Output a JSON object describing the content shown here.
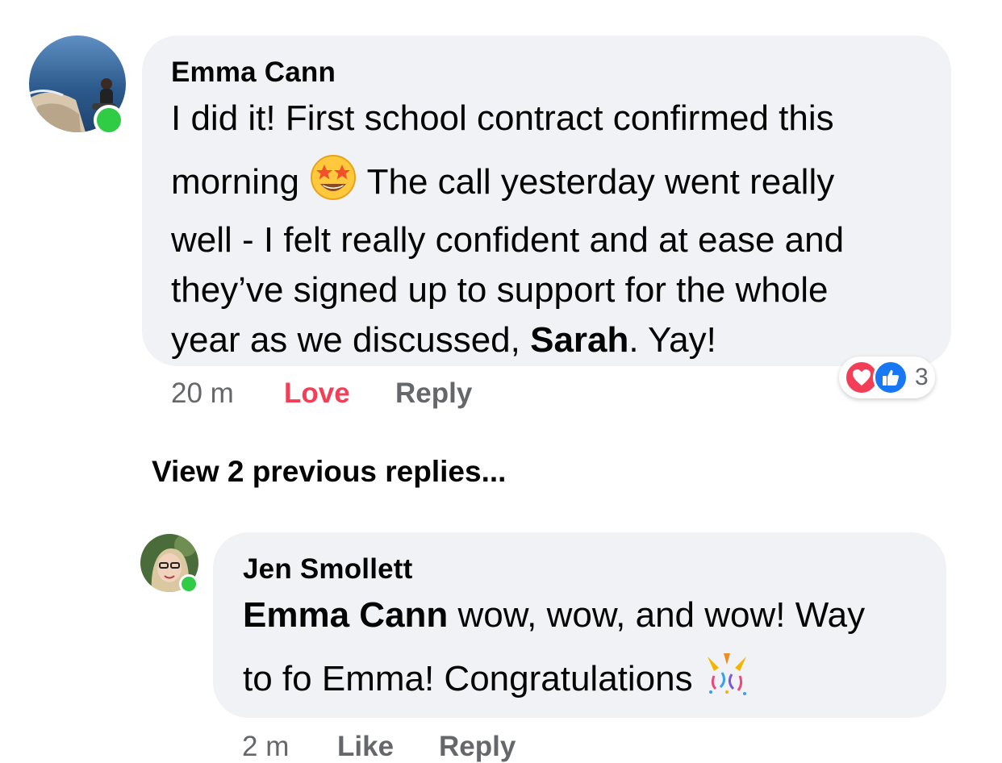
{
  "comment": {
    "author": "Emma Cann",
    "text_line1": "I did it! First school contract confirmed this",
    "text_line2_a": "morning",
    "text_line2_emoji": "star-struck-emoji",
    "text_line2_b": "The call yesterday went really",
    "text_line3": "well - I felt really confident and at ease and",
    "text_line4": "they’ve signed up to support for the whole",
    "text_line5_a": "year as we discussed,",
    "text_line5_mention": "Sarah",
    "text_line5_b": ". Yay!",
    "time": "20 m",
    "love_label": "Love",
    "reply_label": "Reply",
    "reaction_count": "3",
    "reaction_icons": [
      "heart-reaction-icon",
      "like-reaction-icon"
    ],
    "colors": {
      "love": "#f33e58",
      "like": "#1877f2",
      "online": "#31cc46"
    }
  },
  "view_previous_replies": "View 2 previous replies...",
  "reply": {
    "author": "Jen Smollett",
    "mention": "Emma Cann",
    "text_line1_rest": "wow, wow, and wow! Way",
    "text_line2": "to fo Emma! Congratulations",
    "text_line2_emoji": "party-popper-emoji",
    "time": "2 m",
    "like_label": "Like",
    "reply_label": "Reply"
  }
}
